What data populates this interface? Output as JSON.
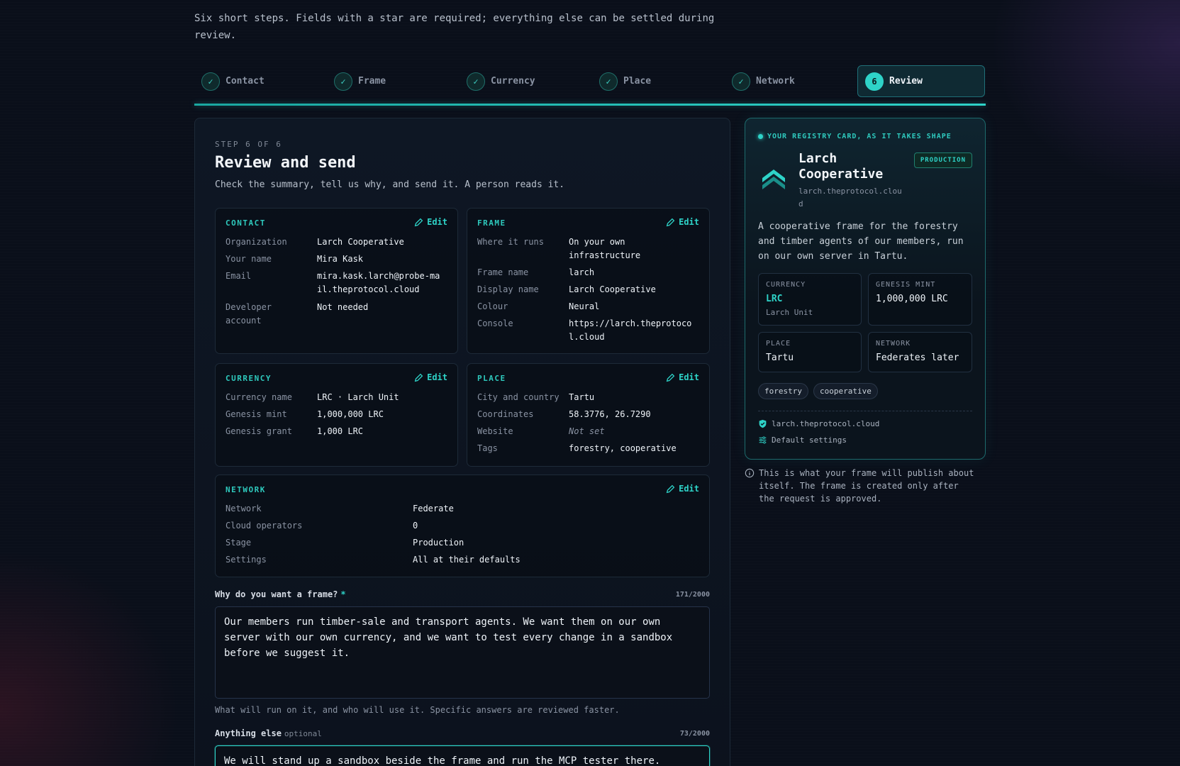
{
  "intro": "Six short steps. Fields with a star are required; everything else can be settled during review.",
  "stepper": {
    "steps": [
      {
        "label": "Contact",
        "done": true
      },
      {
        "label": "Frame",
        "done": true
      },
      {
        "label": "Currency",
        "done": true
      },
      {
        "label": "Place",
        "done": true
      },
      {
        "label": "Network",
        "done": true
      },
      {
        "label": "Review",
        "number": "6",
        "active": true
      }
    ]
  },
  "main": {
    "step_label": "STEP 6 OF 6",
    "title": "Review and send",
    "subtitle": "Check the summary, tell us why, and send it. A person reads it.",
    "edit_label": "Edit",
    "contact": {
      "heading": "CONTACT",
      "rows": [
        {
          "k": "Organization",
          "v": "Larch Cooperative"
        },
        {
          "k": "Your name",
          "v": "Mira Kask"
        },
        {
          "k": "Email",
          "v": "mira.kask.larch@probe-mail.theprotocol.cloud"
        },
        {
          "k": "Developer account",
          "v": "Not needed"
        }
      ]
    },
    "frame": {
      "heading": "FRAME",
      "rows": [
        {
          "k": "Where it runs",
          "v": "On your own infrastructure"
        },
        {
          "k": "Frame name",
          "v": "larch"
        },
        {
          "k": "Display name",
          "v": "Larch Cooperative"
        },
        {
          "k": "Colour",
          "v": "Neural"
        },
        {
          "k": "Console",
          "v": "https://larch.theprotocol.cloud"
        }
      ]
    },
    "currency": {
      "heading": "CURRENCY",
      "rows": [
        {
          "k": "Currency name",
          "v": "LRC · Larch Unit"
        },
        {
          "k": "Genesis mint",
          "v": "1,000,000 LRC"
        },
        {
          "k": "Genesis grant",
          "v": "1,000 LRC"
        }
      ]
    },
    "place": {
      "heading": "PLACE",
      "rows": [
        {
          "k": "City and country",
          "v": "Tartu"
        },
        {
          "k": "Coordinates",
          "v": "58.3776, 26.7290"
        },
        {
          "k": "Website",
          "v": "Not set"
        },
        {
          "k": "Tags",
          "v": "forestry, cooperative"
        }
      ]
    },
    "network": {
      "heading": "NETWORK",
      "rows": [
        {
          "k": "Network",
          "v": "Federate"
        },
        {
          "k": "Cloud operators",
          "v": "0"
        },
        {
          "k": "Stage",
          "v": "Production"
        },
        {
          "k": "Settings",
          "v": "All at their defaults"
        }
      ]
    },
    "why": {
      "label": "Why do you want a frame?",
      "star": "*",
      "counter": "171/2000",
      "value": "Our members run timber-sale and transport agents. We want them on our own server with our own currency, and we want to test every change in a sandbox before we suggest it.",
      "hint": "What will run on it, and who will use it. Specific answers are reviewed faster."
    },
    "else": {
      "label": "Anything else",
      "optional": "optional",
      "counter": "73/2000",
      "value": "We will stand up a sandbox beside the frame and run the MCP tester there."
    }
  },
  "side": {
    "heading": "YOUR REGISTRY CARD, AS IT TAKES SHAPE",
    "org_name": "Larch Cooperative",
    "org_host": "larch.theprotocol.cloud",
    "badge": "PRODUCTION",
    "description": "A cooperative frame for the forestry and timber agents of our members, run on our own server in Tartu.",
    "currency": {
      "label": "CURRENCY",
      "value": "LRC",
      "sub": "Larch Unit"
    },
    "mint": {
      "label": "GENESIS MINT",
      "value": "1,000,000 LRC"
    },
    "place": {
      "label": "PLACE",
      "value": "Tartu"
    },
    "network": {
      "label": "NETWORK",
      "value": "Federates later"
    },
    "tags": [
      "forestry",
      "cooperative"
    ],
    "domain_line": "larch.theprotocol.cloud",
    "settings_line": "Default settings"
  },
  "note": "This is what your frame will publish about itself. The frame is created only after the request is approved.",
  "colors": {
    "accent": "#2ed3c8",
    "background": "#0a0f1a"
  }
}
